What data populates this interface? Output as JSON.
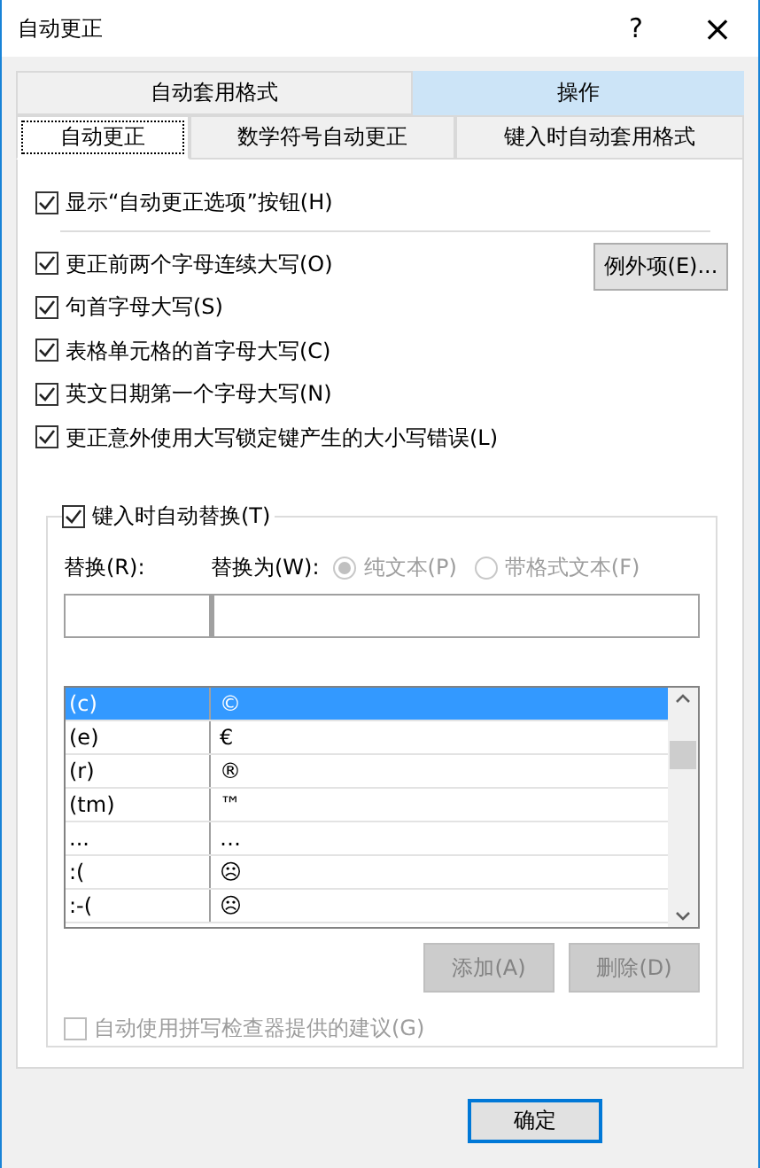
{
  "window": {
    "title": "自动更正",
    "help": "?",
    "close": "×"
  },
  "tab_rows": [
    [
      {
        "label": "自动套用格式",
        "selected": false
      },
      {
        "label": "操作",
        "selected": true
      }
    ],
    [
      {
        "label": "自动更正",
        "selected": true
      },
      {
        "label": "数学符号自动更正",
        "selected": false
      },
      {
        "label": "键入时自动套用格式",
        "selected": false
      }
    ]
  ],
  "show_button_option": {
    "label": "显示“自动更正选项”按钮(H)",
    "checked": true
  },
  "options": [
    {
      "label": "更正前两个字母连续大写(O)",
      "checked": true
    },
    {
      "label": "句首字母大写(S)",
      "checked": true
    },
    {
      "label": "表格单元格的首字母大写(C)",
      "checked": true
    },
    {
      "label": "英文日期第一个字母大写(N)",
      "checked": true
    },
    {
      "label": "更正意外使用大写锁定键产生的大小写错误(L)",
      "checked": true
    }
  ],
  "exceptions_button": "例外项(E)...",
  "replace_group": {
    "label": "键入时自动替换(T)",
    "checked": true,
    "replace_label": "替换(R):",
    "with_label": "替换为(W):",
    "radios": [
      {
        "label": "纯文本(P)",
        "selected": true,
        "disabled": true
      },
      {
        "label": "带格式文本(F)",
        "selected": false,
        "disabled": true
      }
    ],
    "entries": [
      {
        "from": "(c)",
        "to": "©",
        "selected": true
      },
      {
        "from": "(e)",
        "to": "€",
        "selected": false
      },
      {
        "from": "(r)",
        "to": "®",
        "selected": false
      },
      {
        "from": "(tm)",
        "to": "™",
        "selected": false
      },
      {
        "from": "...",
        "to": "…",
        "selected": false
      },
      {
        "from": ":(",
        "to": "☹",
        "selected": false
      },
      {
        "from": ":-(",
        "to": "☹",
        "selected": false
      }
    ],
    "buttons": [
      {
        "label": "添加(A)",
        "disabled": true
      },
      {
        "label": "删除(D)",
        "disabled": true
      }
    ],
    "spelling": {
      "label": "自动使用拼写检查器提供的建议(G)",
      "checked": false,
      "disabled": true
    }
  },
  "ok_button": "确定"
}
